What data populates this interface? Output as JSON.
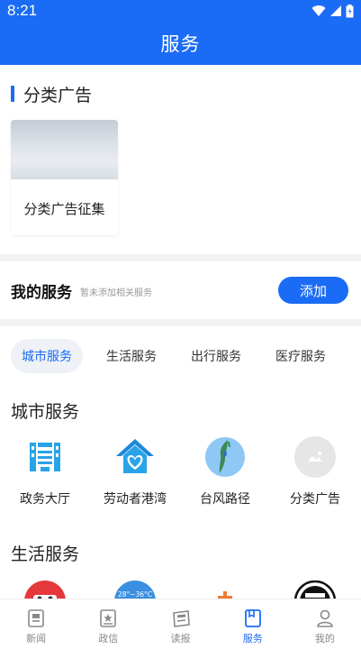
{
  "status": {
    "time": "8:21"
  },
  "header": {
    "title": "服务"
  },
  "ads": {
    "section_title": "分类广告",
    "card_label": "分类广告征集"
  },
  "my_services": {
    "title": "我的服务",
    "subtitle": "暂未添加相关服务",
    "add_label": "添加"
  },
  "tabs": [
    {
      "label": "城市服务",
      "active": true
    },
    {
      "label": "生活服务",
      "active": false
    },
    {
      "label": "出行服务",
      "active": false
    },
    {
      "label": "医疗服务",
      "active": false
    }
  ],
  "city": {
    "title": "城市服务",
    "items": [
      {
        "label": "政务大厅",
        "icon": "government-hall-icon"
      },
      {
        "label": "劳动者港湾",
        "icon": "worker-harbor-icon"
      },
      {
        "label": "台风路径",
        "icon": "typhoon-path-icon"
      },
      {
        "label": "分类广告",
        "icon": "classified-ads-icon"
      }
    ]
  },
  "life": {
    "title": "生活服务",
    "weather_text": "28°~36°C"
  },
  "bottom_nav": [
    {
      "label": "新闻",
      "icon": "news-icon",
      "active": false
    },
    {
      "label": "政信",
      "icon": "government-info-icon",
      "active": false
    },
    {
      "label": "读报",
      "icon": "newspaper-icon",
      "active": false
    },
    {
      "label": "服务",
      "icon": "service-icon",
      "active": true
    },
    {
      "label": "我的",
      "icon": "profile-icon",
      "active": false
    }
  ],
  "colors": {
    "primary": "#1a6bf5",
    "background": "#f2f3f5"
  }
}
